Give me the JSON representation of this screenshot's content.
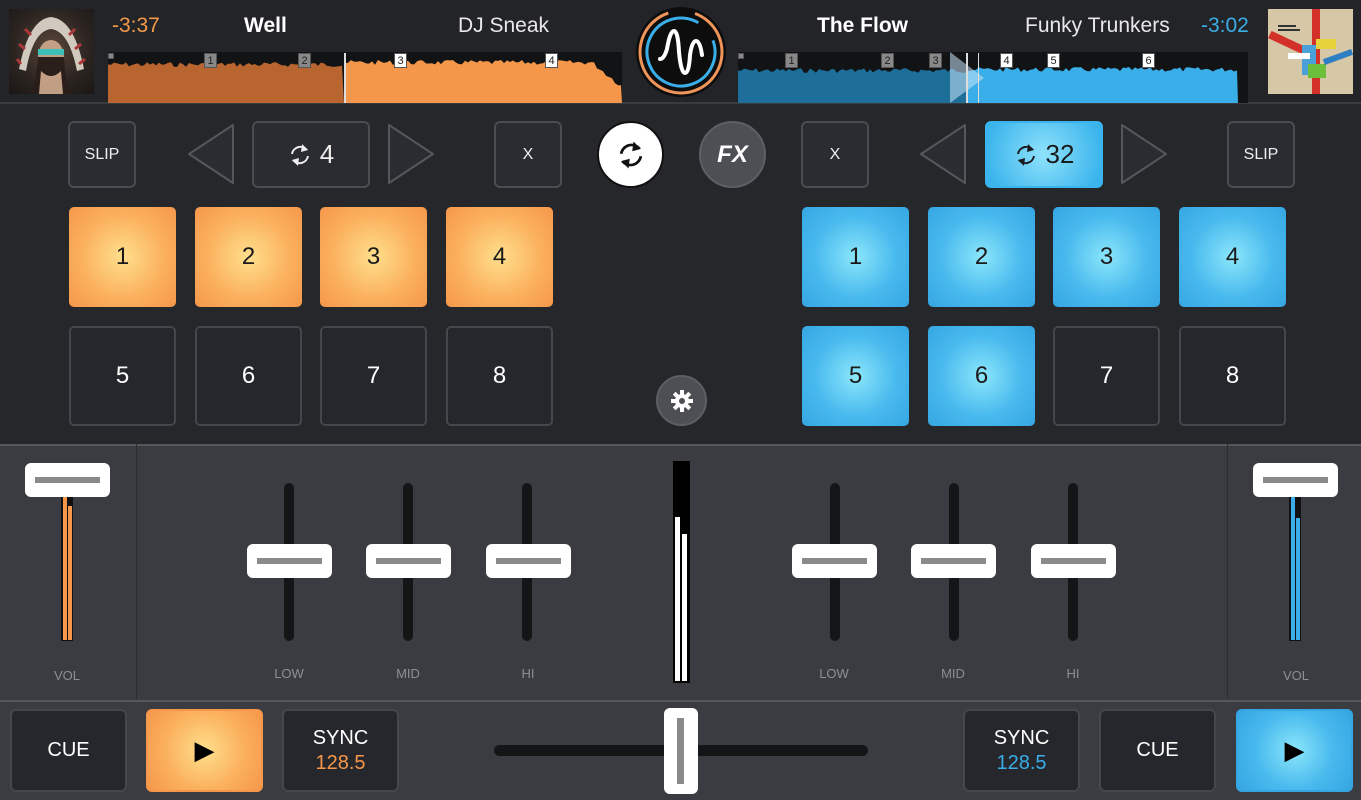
{
  "deck_left": {
    "time_remaining": "-3:37",
    "track_title": "Well",
    "artist": "DJ Sneak",
    "accent_color": "#f5974a",
    "cue_markers": [
      "1",
      "2",
      "3",
      "4"
    ],
    "slip_label": "SLIP",
    "loop_size": "4",
    "loop_clear_label": "X",
    "pads": [
      {
        "label": "1",
        "active": true
      },
      {
        "label": "2",
        "active": true
      },
      {
        "label": "3",
        "active": true
      },
      {
        "label": "4",
        "active": true
      },
      {
        "label": "5",
        "active": false
      },
      {
        "label": "6",
        "active": false
      },
      {
        "label": "7",
        "active": false
      },
      {
        "label": "8",
        "active": false
      }
    ],
    "vol_label": "VOL",
    "eq_labels": [
      "LOW",
      "MID",
      "HI"
    ],
    "cue_label": "CUE",
    "sync_label": "SYNC",
    "bpm": "128.5",
    "play_icon": "▶"
  },
  "deck_right": {
    "time_remaining": "-3:02",
    "track_title": "The Flow",
    "artist": "Funky Trunkers",
    "accent_color": "#3aaee8",
    "cue_markers": [
      "1",
      "2",
      "3",
      "4",
      "5",
      "6"
    ],
    "slip_label": "SLIP",
    "loop_size": "32",
    "loop_clear_label": "X",
    "pads": [
      {
        "label": "1",
        "active": true
      },
      {
        "label": "2",
        "active": true
      },
      {
        "label": "3",
        "active": true
      },
      {
        "label": "4",
        "active": true
      },
      {
        "label": "5",
        "active": true
      },
      {
        "label": "6",
        "active": true
      },
      {
        "label": "7",
        "active": false
      },
      {
        "label": "8",
        "active": false
      }
    ],
    "vol_label": "VOL",
    "eq_labels": [
      "LOW",
      "MID",
      "HI"
    ],
    "cue_label": "CUE",
    "sync_label": "SYNC",
    "bpm": "128.5",
    "play_icon": "▶"
  },
  "center": {
    "fx_label": "FX",
    "crossfader_position": 0.5
  },
  "icons": {
    "logo": "waveform-logo-icon",
    "sync": "sync-icon",
    "loop": "loop-icon",
    "settings": "gear-icon"
  }
}
